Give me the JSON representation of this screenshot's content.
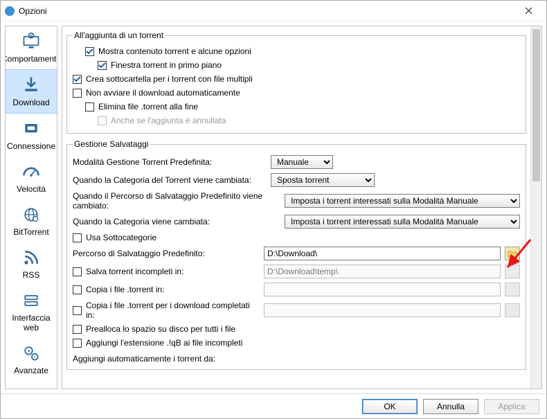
{
  "window": {
    "title": "Opzioni"
  },
  "sidebar": {
    "items": [
      {
        "label": "Comportamento",
        "name": "sidebar-item-behavior"
      },
      {
        "label": "Download",
        "name": "sidebar-item-download"
      },
      {
        "label": "Connessione",
        "name": "sidebar-item-connection"
      },
      {
        "label": "Velocità",
        "name": "sidebar-item-speed"
      },
      {
        "label": "BitTorrent",
        "name": "sidebar-item-bittorrent"
      },
      {
        "label": "RSS",
        "name": "sidebar-item-rss"
      },
      {
        "label": "Interfaccia web",
        "name": "sidebar-item-webui"
      },
      {
        "label": "Avanzate",
        "name": "sidebar-item-advanced"
      }
    ],
    "selectedIndex": 1
  },
  "section_add": {
    "legend": "All'aggiunta di un torrent",
    "show_content": {
      "label": "Mostra contenuto torrent e alcune opzioni",
      "checked": true
    },
    "bring_front": {
      "label": "Finestra torrent in primo piano",
      "checked": true
    },
    "create_subdir": {
      "label": "Crea sottocartella per i torrent con file multipli",
      "checked": true
    },
    "no_autostart": {
      "label": "Non avviare il download automaticamente",
      "checked": false
    },
    "delete_torrent": {
      "label": "Elimina file .torrent alla fine",
      "checked": false
    },
    "even_if_cancel": {
      "label": "Anche se l'aggiunta è annullata",
      "checked": false,
      "disabled": true
    }
  },
  "section_save": {
    "legend": "Gestione Salvataggi",
    "default_mode_label": "Modalità Gestione Torrent Predefinita:",
    "default_mode_value": "Manuale",
    "on_category_change_label": "Quando la Categoria del Torrent viene cambiata:",
    "on_category_change_value": "Sposta torrent",
    "on_default_path_change_label": "Quando il Percorso di Salvataggio Predefinito viene cambiato:",
    "on_default_path_change_value": "Imposta i torrent interessati sulla Modalità Manuale",
    "on_category_changed_label": "Quando la Categoria viene cambiata:",
    "on_category_changed_value": "Imposta i torrent interessati sulla Modalità Manuale",
    "use_subcat": {
      "label": "Usa Sottocategorie",
      "checked": false
    },
    "default_path_label": "Percorso di Salvataggio Predefinito:",
    "default_path_value": "D:\\Download\\",
    "incomplete": {
      "label": "Salva torrent incompleti in:",
      "checked": false,
      "placeholder": "D:\\Download\\temp\\"
    },
    "copy_torrent": {
      "label": "Copia i file .torrent in:",
      "checked": false,
      "value": ""
    },
    "copy_finished": {
      "label": "Copia i file .torrent per i download completati in:",
      "checked": false,
      "value": ""
    },
    "preallocate": {
      "label": "Prealloca lo spazio su disco per tutti i file",
      "checked": false
    },
    "append_ext": {
      "label": "Aggiungi l'estensione .!qB ai file incompleti",
      "checked": false
    },
    "autoadd_legend": "Aggiungi automaticamente i torrent da:"
  },
  "footer": {
    "ok": "OK",
    "cancel": "Annulla",
    "apply": "Applica"
  }
}
